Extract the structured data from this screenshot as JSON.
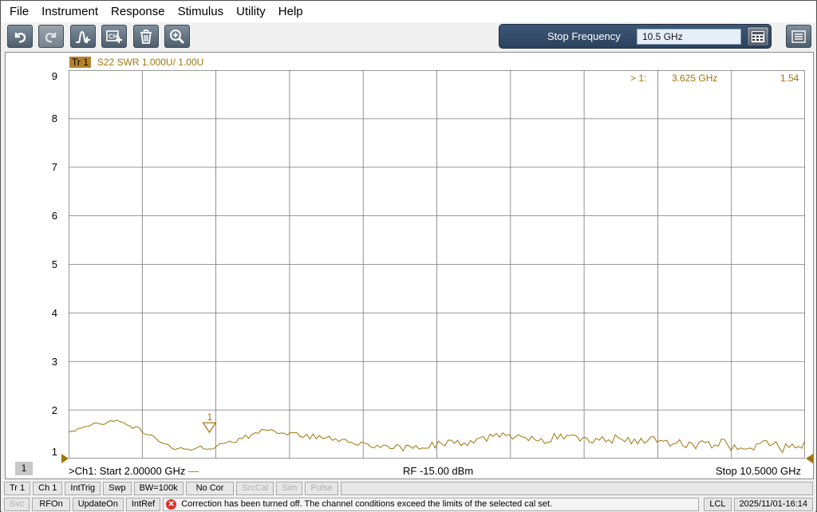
{
  "menu": [
    "File",
    "Instrument",
    "Response",
    "Stimulus",
    "Utility",
    "Help"
  ],
  "toolbar": {
    "icons": [
      "undo-icon",
      "redo-icon",
      "add-marker-icon",
      "add-channel-icon",
      "delete-icon",
      "zoom-icon"
    ],
    "stop_label": "Stop Frequency",
    "stop_value": "10.5 GHz"
  },
  "trace": {
    "tag": "Tr 1",
    "description": "S22 SWR 1.000U/  1.00U",
    "color": "#a0740c"
  },
  "marker": {
    "label": "> 1:",
    "freq": "3.625  GHz",
    "value": "1.54",
    "number": "1"
  },
  "channel_number": "1",
  "footer": {
    "start": ">Ch1:  Start  2.00000 GHz",
    "rf": "RF  -15.00 dBm",
    "stop": "Stop  10.5000 GHz"
  },
  "status1": [
    "Tr 1",
    "Ch 1",
    "IntTrig",
    "Swp",
    "BW=100k",
    "No Cor",
    "SrcCal",
    "Sim",
    "Pulse"
  ],
  "status1_dim": [
    false,
    false,
    false,
    false,
    false,
    false,
    true,
    true,
    true
  ],
  "status2": [
    "Svc",
    "RFOn",
    "UpdateOn",
    "IntRef"
  ],
  "status2_dim": [
    true,
    false,
    false,
    false
  ],
  "status_message": "Correction has been turned off. The channel conditions exceed the limits of the selected cal set.",
  "status_lcl": "LCL",
  "status_time": "2025/11/01-16:14",
  "chart_data": {
    "type": "line",
    "xlabel": "",
    "ylabel": "",
    "x_range_ghz": [
      2.0,
      10.5
    ],
    "ylim": [
      1,
      9
    ],
    "yticks": [
      "9",
      "8",
      "7",
      "6",
      "5",
      "4",
      "3",
      "2",
      "1"
    ],
    "grid": true,
    "series": [
      {
        "values": [
          1.55,
          1.62,
          1.73,
          1.72,
          1.78,
          1.68,
          1.6,
          1.45,
          1.3,
          1.22,
          1.18,
          1.25,
          1.22,
          1.3,
          1.36,
          1.45,
          1.54,
          1.6,
          1.52,
          1.5,
          1.46,
          1.45,
          1.4,
          1.38,
          1.36,
          1.3,
          1.28,
          1.26,
          1.22,
          1.24,
          1.26,
          1.28,
          1.33,
          1.3,
          1.36,
          1.4,
          1.45,
          1.48,
          1.5,
          1.42,
          1.38,
          1.45,
          1.5,
          1.44,
          1.4,
          1.37,
          1.42,
          1.38,
          1.4,
          1.36,
          1.34,
          1.3,
          1.32,
          1.3,
          1.28,
          1.3,
          1.26,
          1.25,
          1.28,
          1.3,
          1.22,
          1.24,
          1.26
        ]
      }
    ]
  }
}
